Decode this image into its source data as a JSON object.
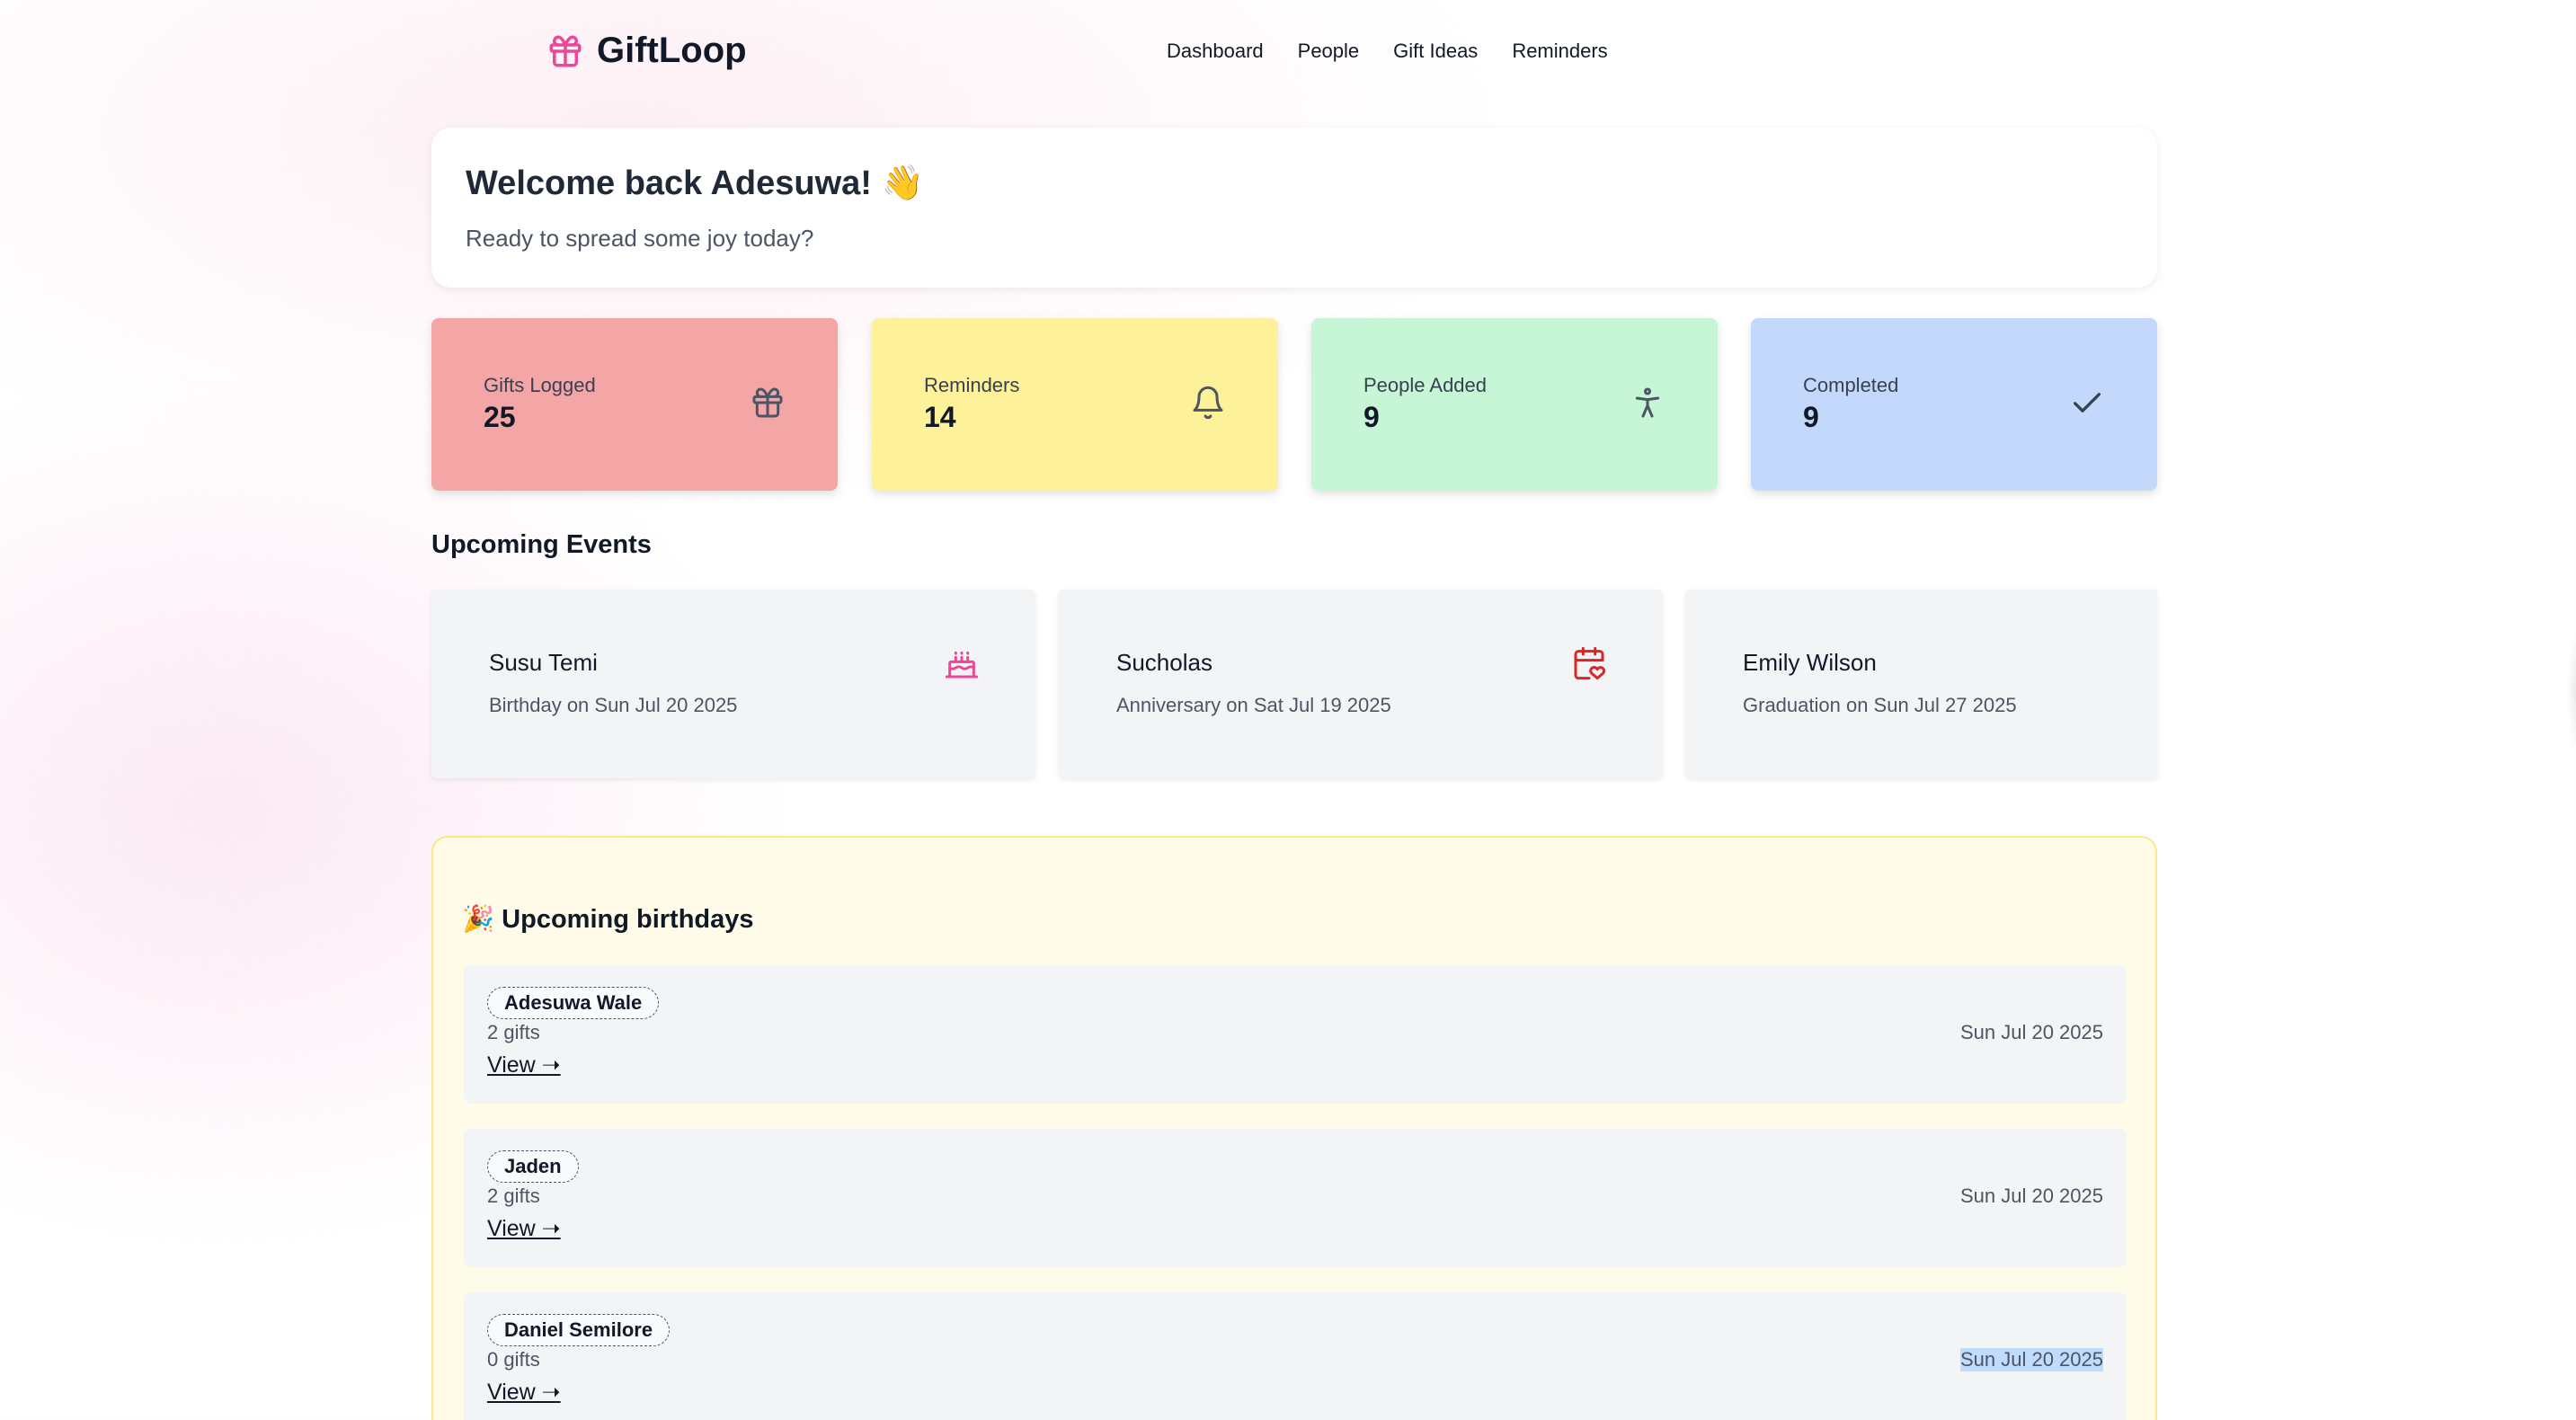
{
  "app": {
    "name": "GiftLoop",
    "accent": "#ec4899"
  },
  "nav": {
    "links": [
      "Dashboard",
      "People",
      "Gift Ideas",
      "Reminders"
    ]
  },
  "welcome": {
    "title": "Welcome back Adesuwa! 👋",
    "subtitle": "Ready to spread some joy today?"
  },
  "stats": [
    {
      "label": "Gifts Logged",
      "value": "25",
      "icon": "gift-icon",
      "color": "#f4a6a6"
    },
    {
      "label": "Reminders",
      "value": "14",
      "icon": "bell-icon",
      "color": "#fdf19a"
    },
    {
      "label": "People Added",
      "value": "9",
      "icon": "person-icon",
      "color": "#c6f6d5"
    },
    {
      "label": "Completed",
      "value": "9",
      "icon": "check-icon",
      "color": "#c3d8fb"
    }
  ],
  "upcoming_events": {
    "title": "Upcoming Events",
    "items": [
      {
        "name": "Susu Temi",
        "detail": "Birthday on Sun Jul 20 2025",
        "icon": "cake-icon"
      },
      {
        "name": "Sucholas",
        "detail": "Anniversary on Sat Jul 19 2025",
        "icon": "calendar-heart-icon"
      },
      {
        "name": "Emily Wilson",
        "detail": "Graduation on Sun Jul 27 2025",
        "icon": "graduation-icon"
      }
    ]
  },
  "birthdays": {
    "title": "🎉 Upcoming birthdays",
    "view_label": "View ➝",
    "items": [
      {
        "name": "Adesuwa Wale",
        "gifts": "2 gifts",
        "date": "Sun Jul 20 2025"
      },
      {
        "name": "Jaden",
        "gifts": "2 gifts",
        "date": "Sun Jul 20 2025"
      },
      {
        "name": "Daniel Semilore",
        "gifts": "0 gifts",
        "date": "Sun Jul 20 2025"
      }
    ]
  }
}
